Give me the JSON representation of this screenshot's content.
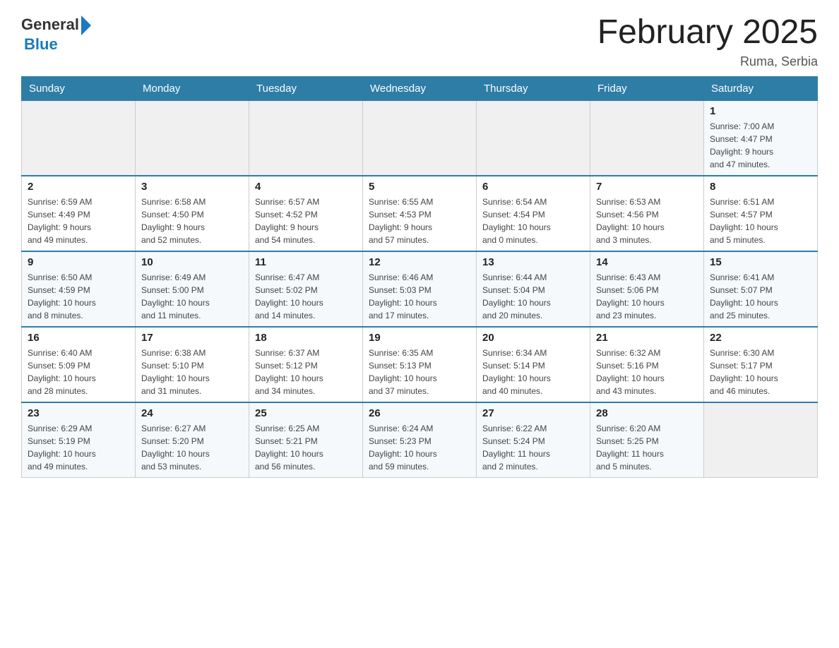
{
  "header": {
    "logo_general": "General",
    "logo_blue": "Blue",
    "month_title": "February 2025",
    "location": "Ruma, Serbia"
  },
  "days_of_week": [
    "Sunday",
    "Monday",
    "Tuesday",
    "Wednesday",
    "Thursday",
    "Friday",
    "Saturday"
  ],
  "weeks": [
    [
      {
        "day": "",
        "info": ""
      },
      {
        "day": "",
        "info": ""
      },
      {
        "day": "",
        "info": ""
      },
      {
        "day": "",
        "info": ""
      },
      {
        "day": "",
        "info": ""
      },
      {
        "day": "",
        "info": ""
      },
      {
        "day": "1",
        "info": "Sunrise: 7:00 AM\nSunset: 4:47 PM\nDaylight: 9 hours\nand 47 minutes."
      }
    ],
    [
      {
        "day": "2",
        "info": "Sunrise: 6:59 AM\nSunset: 4:49 PM\nDaylight: 9 hours\nand 49 minutes."
      },
      {
        "day": "3",
        "info": "Sunrise: 6:58 AM\nSunset: 4:50 PM\nDaylight: 9 hours\nand 52 minutes."
      },
      {
        "day": "4",
        "info": "Sunrise: 6:57 AM\nSunset: 4:52 PM\nDaylight: 9 hours\nand 54 minutes."
      },
      {
        "day": "5",
        "info": "Sunrise: 6:55 AM\nSunset: 4:53 PM\nDaylight: 9 hours\nand 57 minutes."
      },
      {
        "day": "6",
        "info": "Sunrise: 6:54 AM\nSunset: 4:54 PM\nDaylight: 10 hours\nand 0 minutes."
      },
      {
        "day": "7",
        "info": "Sunrise: 6:53 AM\nSunset: 4:56 PM\nDaylight: 10 hours\nand 3 minutes."
      },
      {
        "day": "8",
        "info": "Sunrise: 6:51 AM\nSunset: 4:57 PM\nDaylight: 10 hours\nand 5 minutes."
      }
    ],
    [
      {
        "day": "9",
        "info": "Sunrise: 6:50 AM\nSunset: 4:59 PM\nDaylight: 10 hours\nand 8 minutes."
      },
      {
        "day": "10",
        "info": "Sunrise: 6:49 AM\nSunset: 5:00 PM\nDaylight: 10 hours\nand 11 minutes."
      },
      {
        "day": "11",
        "info": "Sunrise: 6:47 AM\nSunset: 5:02 PM\nDaylight: 10 hours\nand 14 minutes."
      },
      {
        "day": "12",
        "info": "Sunrise: 6:46 AM\nSunset: 5:03 PM\nDaylight: 10 hours\nand 17 minutes."
      },
      {
        "day": "13",
        "info": "Sunrise: 6:44 AM\nSunset: 5:04 PM\nDaylight: 10 hours\nand 20 minutes."
      },
      {
        "day": "14",
        "info": "Sunrise: 6:43 AM\nSunset: 5:06 PM\nDaylight: 10 hours\nand 23 minutes."
      },
      {
        "day": "15",
        "info": "Sunrise: 6:41 AM\nSunset: 5:07 PM\nDaylight: 10 hours\nand 25 minutes."
      }
    ],
    [
      {
        "day": "16",
        "info": "Sunrise: 6:40 AM\nSunset: 5:09 PM\nDaylight: 10 hours\nand 28 minutes."
      },
      {
        "day": "17",
        "info": "Sunrise: 6:38 AM\nSunset: 5:10 PM\nDaylight: 10 hours\nand 31 minutes."
      },
      {
        "day": "18",
        "info": "Sunrise: 6:37 AM\nSunset: 5:12 PM\nDaylight: 10 hours\nand 34 minutes."
      },
      {
        "day": "19",
        "info": "Sunrise: 6:35 AM\nSunset: 5:13 PM\nDaylight: 10 hours\nand 37 minutes."
      },
      {
        "day": "20",
        "info": "Sunrise: 6:34 AM\nSunset: 5:14 PM\nDaylight: 10 hours\nand 40 minutes."
      },
      {
        "day": "21",
        "info": "Sunrise: 6:32 AM\nSunset: 5:16 PM\nDaylight: 10 hours\nand 43 minutes."
      },
      {
        "day": "22",
        "info": "Sunrise: 6:30 AM\nSunset: 5:17 PM\nDaylight: 10 hours\nand 46 minutes."
      }
    ],
    [
      {
        "day": "23",
        "info": "Sunrise: 6:29 AM\nSunset: 5:19 PM\nDaylight: 10 hours\nand 49 minutes."
      },
      {
        "day": "24",
        "info": "Sunrise: 6:27 AM\nSunset: 5:20 PM\nDaylight: 10 hours\nand 53 minutes."
      },
      {
        "day": "25",
        "info": "Sunrise: 6:25 AM\nSunset: 5:21 PM\nDaylight: 10 hours\nand 56 minutes."
      },
      {
        "day": "26",
        "info": "Sunrise: 6:24 AM\nSunset: 5:23 PM\nDaylight: 10 hours\nand 59 minutes."
      },
      {
        "day": "27",
        "info": "Sunrise: 6:22 AM\nSunset: 5:24 PM\nDaylight: 11 hours\nand 2 minutes."
      },
      {
        "day": "28",
        "info": "Sunrise: 6:20 AM\nSunset: 5:25 PM\nDaylight: 11 hours\nand 5 minutes."
      },
      {
        "day": "",
        "info": ""
      }
    ]
  ]
}
